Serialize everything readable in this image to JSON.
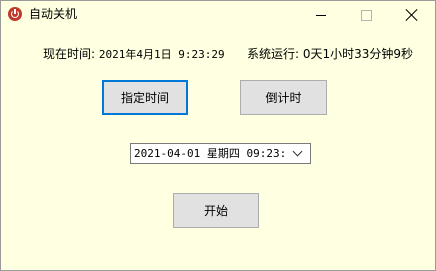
{
  "window": {
    "title": "自动关机",
    "app_icon": "power-icon",
    "controls": {
      "minimize": "minimize-icon",
      "maximize": "maximize-icon",
      "close": "close-icon"
    }
  },
  "status": {
    "now_label": "现在时间:",
    "now_value": "2021年4月1日 9:23:29",
    "uptime_label": "系统运行:",
    "uptime_value": "0天1小时33分钟9秒"
  },
  "buttons": {
    "set_time": "指定时间",
    "countdown": "倒计时",
    "start": "开始"
  },
  "datetime_picker": {
    "value": "2021-04-01 星期四 09:23:"
  },
  "colors": {
    "background": "#ffffe1",
    "button": "#e1e1e1",
    "focus_border": "#0078d7",
    "icon_red": "#c0392b"
  }
}
